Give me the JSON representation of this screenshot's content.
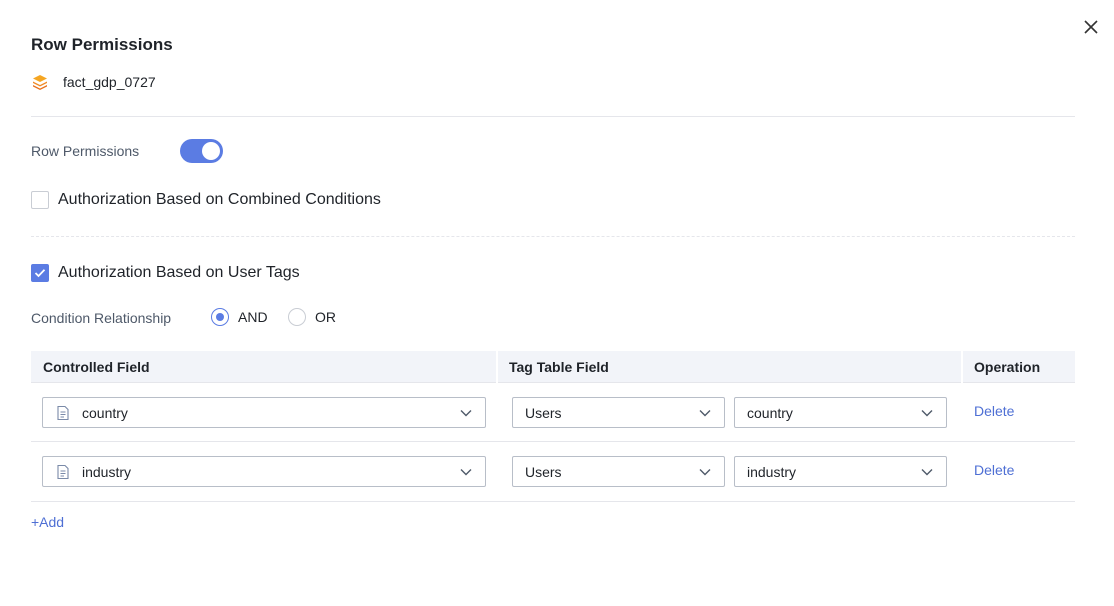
{
  "dialog": {
    "title": "Row Permissions",
    "dataset_name": "fact_gdp_0727",
    "row_permissions_label": "Row Permissions",
    "row_permissions_enabled": true
  },
  "combined": {
    "label": "Authorization Based on Combined Conditions",
    "checked": false
  },
  "user_tags": {
    "label": "Authorization Based on User Tags",
    "checked": true,
    "condition_label": "Condition Relationship",
    "options": [
      "AND",
      "OR"
    ],
    "selected": "AND"
  },
  "table": {
    "headers": {
      "controlled_field": "Controlled Field",
      "tag_table_field": "Tag Table Field",
      "operation": "Operation"
    },
    "rows": [
      {
        "controlled_field": "country",
        "tag_table": "Users",
        "tag_field": "country",
        "action": "Delete"
      },
      {
        "controlled_field": "industry",
        "tag_table": "Users",
        "tag_field": "industry",
        "action": "Delete"
      }
    ],
    "add_label": "+Add"
  },
  "colors": {
    "accent": "#5b7ce3",
    "link": "#4e6fd4",
    "table_header_bg": "#f2f4f9",
    "dataset_icon": "#f08a24"
  },
  "icons": {
    "close": "close-icon",
    "dataset": "layers-icon",
    "field": "document-icon",
    "dropdown": "chevron-down-icon",
    "check": "check-icon"
  }
}
